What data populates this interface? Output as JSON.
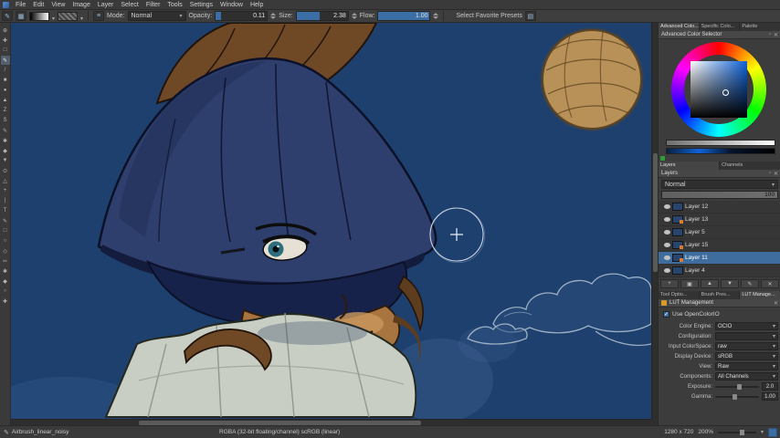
{
  "colors": {
    "accent": "#3B6EA5",
    "panel": "#3C3C3C",
    "canvas_blue": "#1E406E",
    "selection": "#3F6E9E"
  },
  "menu": {
    "items": [
      "File",
      "Edit",
      "View",
      "Image",
      "Layer",
      "Select",
      "Filter",
      "Tools",
      "Settings",
      "Window",
      "Help"
    ]
  },
  "toolbar": {
    "mode_label": "Mode:",
    "mode_value": "Normal",
    "opacity_label": "Opacity:",
    "opacity_value": "0.11",
    "opacity_fill_pct": 11,
    "size_label": "Size:",
    "size_value": "2.38",
    "size_fill_pct": 45,
    "flow_label": "Flow:",
    "flow_value": "1.00",
    "flow_fill_pct": 100,
    "favorites_label": "Select Favorite Presets"
  },
  "toolbox": {
    "tools": [
      {
        "name": "transform-tool",
        "glyph": "⊕"
      },
      {
        "name": "move-tool",
        "glyph": "✚"
      },
      {
        "name": "crop-tool",
        "glyph": "□"
      },
      {
        "name": "freehand-brush-tool",
        "glyph": "✎",
        "selected": true
      },
      {
        "name": "line-tool",
        "glyph": "/"
      },
      {
        "name": "rectangle-tool",
        "glyph": "■"
      },
      {
        "name": "ellipse-tool",
        "glyph": "●"
      },
      {
        "name": "polygon-tool",
        "glyph": "▲"
      },
      {
        "name": "polyline-tool",
        "glyph": "Z"
      },
      {
        "name": "bezier-curve-tool",
        "glyph": "S"
      },
      {
        "name": "dynamic-brush-tool",
        "glyph": "✎"
      },
      {
        "name": "multibrush-tool",
        "glyph": "✱"
      },
      {
        "name": "fill-tool",
        "glyph": "◆"
      },
      {
        "name": "gradient-tool",
        "glyph": "▼"
      },
      {
        "name": "color-sampler-tool",
        "glyph": "⊙"
      },
      {
        "name": "pattern-edit-tool",
        "glyph": "△"
      },
      {
        "name": "assistants-tool",
        "glyph": "+"
      },
      {
        "name": "measure-tool",
        "glyph": "|"
      },
      {
        "name": "text-tool",
        "glyph": "T"
      },
      {
        "name": "calligraphy-tool",
        "glyph": "✎"
      },
      {
        "name": "rectangular-select-tool",
        "glyph": "□"
      },
      {
        "name": "elliptical-select-tool",
        "glyph": "○"
      },
      {
        "name": "polygonal-select-tool",
        "glyph": "◇"
      },
      {
        "name": "outline-select-tool",
        "glyph": "✂"
      },
      {
        "name": "similar-select-tool",
        "glyph": "✱"
      },
      {
        "name": "contiguous-select-tool",
        "glyph": "◆"
      },
      {
        "name": "zoom-tool",
        "glyph": "○"
      },
      {
        "name": "pan-tool",
        "glyph": "✚"
      }
    ]
  },
  "right_panel": {
    "top_tabs": [
      "Advanced Colo...",
      "Specific Colo...",
      "Palette"
    ],
    "active_top_tab": 0,
    "color_selector_title": "Advanced Color Selector",
    "layers_tabs": [
      "Layers",
      "Channels"
    ],
    "active_layers_tab": 0,
    "bottom_tabs": [
      "Tool Optio...",
      "Brush Pres...",
      "LUT Manage..."
    ],
    "active_bottom_tab": 2
  },
  "layers": {
    "title": "Layers",
    "blend_mode": "Normal",
    "opacity": "100",
    "items": [
      {
        "name": "Layer 12",
        "selected": false,
        "badge": false
      },
      {
        "name": "Layer 13",
        "selected": false,
        "badge": true
      },
      {
        "name": "Layer 5",
        "selected": false,
        "badge": false
      },
      {
        "name": "Layer 15",
        "selected": false,
        "badge": true
      },
      {
        "name": "Layer 11",
        "selected": true,
        "badge": true
      },
      {
        "name": "Layer 4",
        "selected": false,
        "badge": false
      }
    ],
    "buttons": [
      {
        "name": "add-layer-button",
        "glyph": "+"
      },
      {
        "name": "duplicate-layer-button",
        "glyph": "▣"
      },
      {
        "name": "move-layer-up-button",
        "glyph": "▲"
      },
      {
        "name": "move-layer-down-button",
        "glyph": "▼"
      },
      {
        "name": "layer-properties-button",
        "glyph": "✎"
      },
      {
        "name": "delete-layer-button",
        "glyph": "✕"
      }
    ]
  },
  "lut": {
    "title": "LUT Management",
    "use_ocio": "Use OpenColorIO",
    "rows": [
      {
        "label": "Color Engine:",
        "value": "OCIO",
        "type": "dropdown"
      },
      {
        "label": "Configuration:",
        "value": "",
        "type": "dropdown"
      },
      {
        "label": "Input ColorSpace:",
        "value": "raw",
        "type": "dropdown"
      },
      {
        "label": "Display Device:",
        "value": "sRGB",
        "type": "dropdown"
      },
      {
        "label": "View:",
        "value": "Raw",
        "type": "dropdown"
      },
      {
        "label": "Components:",
        "value": "All Channels",
        "type": "dropdown"
      },
      {
        "label": "Exposure:",
        "value": "2.0",
        "type": "slider",
        "pct": 50
      },
      {
        "label": "Gamma:",
        "value": "1.00",
        "type": "slider",
        "pct": 40
      }
    ]
  },
  "statusbar": {
    "brush_name": "Airbrush_linear_noisy",
    "color_info": "RGBA (32-bit floating/channel)  scRGB (linear)",
    "canvas_size": "1280 x 720",
    "zoom": "200%"
  }
}
